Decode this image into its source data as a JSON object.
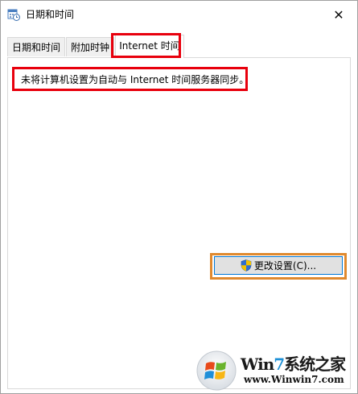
{
  "window": {
    "title": "日期和时间",
    "close_glyph": "✕"
  },
  "tabs": [
    {
      "label": "日期和时间",
      "active": false
    },
    {
      "label": "附加时钟",
      "active": false
    },
    {
      "label": "Internet 时间",
      "active": true
    }
  ],
  "internet_time": {
    "status_message": "未将计算机设置为自动与 Internet 时间服务器同步。",
    "change_settings_label": "更改设置(C)...",
    "change_settings_icon": "uac-shield-icon"
  },
  "watermark": {
    "title_prefix": "Win",
    "title_seven": "7",
    "title_suffix": "系统之家",
    "url": "www.Winwin7.com"
  },
  "colors": {
    "highlight_red": "#e8000d",
    "highlight_orange": "#e0892e",
    "button_border": "#0078d7",
    "button_face": "#e1e1e1"
  }
}
